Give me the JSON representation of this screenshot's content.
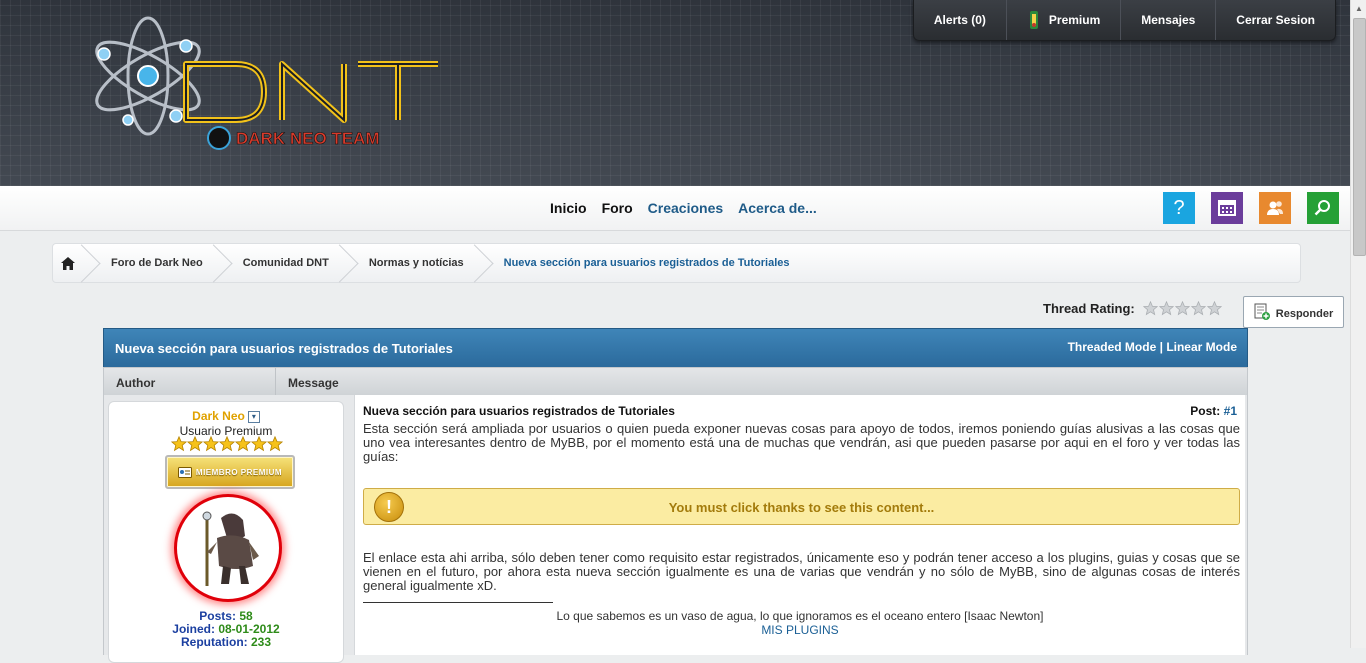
{
  "topbar": {
    "alerts": "Alerts (0)",
    "premium": "Premium",
    "messages": "Mensajes",
    "logout": "Cerrar Sesion"
  },
  "logo": {
    "main_text": "DNT",
    "sub_text": "DARK NEO TEAM"
  },
  "nav": {
    "inicio": "Inicio",
    "foro": "Foro",
    "creaciones": "Creaciones",
    "acerca": "Acerca de...",
    "icons": [
      {
        "name": "help-icon",
        "glyph": "?",
        "color": "#1aa5e0"
      },
      {
        "name": "calendar-icon",
        "glyph": "▦",
        "color": "#6b3d9b"
      },
      {
        "name": "members-icon",
        "glyph": "👥",
        "color": "#e8892f"
      },
      {
        "name": "search-icon",
        "glyph": "⌕",
        "color": "#25a036"
      }
    ]
  },
  "breadcrumb": {
    "items": [
      "Foro de Dark Neo",
      "Comunidad DNT",
      "Normas y notícias",
      "Nueva sección para usuarios registrados de Tutoriales"
    ]
  },
  "rating": {
    "label": "Thread Rating:",
    "value": 0,
    "max": 5
  },
  "reply_button": "Responder",
  "thread": {
    "title": "Nueva sección para usuarios registrados de Tutoriales",
    "threaded": "Threaded Mode",
    "sep": "|",
    "linear": "Linear Mode",
    "col_author": "Author",
    "col_message": "Message"
  },
  "author": {
    "name": "Dark Neo",
    "role": "Usuario Premium",
    "stars": 7,
    "badge": "MIEMBRO PREMIUM",
    "posts_label": "Posts:",
    "posts_value": "58",
    "joined_label": "Joined:",
    "joined_value": "08-01-2012",
    "rep_label": "Reputation:",
    "rep_value": "233",
    "colors": {
      "name": "#e0a200",
      "avatar_ring": "#e0000a"
    }
  },
  "post": {
    "title": "Nueva sección para usuarios registrados de Tutoriales",
    "post_label": "Post:",
    "post_number": "#1",
    "paragraph1": "Esta sección será ampliada por usuarios o quien pueda exponer nuevas cosas para apoyo de todos, iremos poniendo guías alusivas a las cosas que uno vea interesantes dentro de MyBB, por el momento está una de muchas que vendrán, asi que pueden pasarse por aqui en el foro y ver todas las guías:",
    "hidden_notice": "You must click thanks to see this content...",
    "paragraph2": "El enlace esta ahi arriba, sólo deben tener como requisito estar registrados, únicamente eso y podrán tener acceso a los plugins, guias y cosas que se vienen en el futuro, por ahora esta nueva sección igualmente es una de varias que vendrán y no sólo de MyBB, sino de algunas cosas de interés general igualmente xD.",
    "signature_quote": "Lo que sabemos es un vaso de agua, lo que ignoramos es el oceano entero [Isaac Newton]",
    "signature_link": "MIS PLUGINS"
  }
}
